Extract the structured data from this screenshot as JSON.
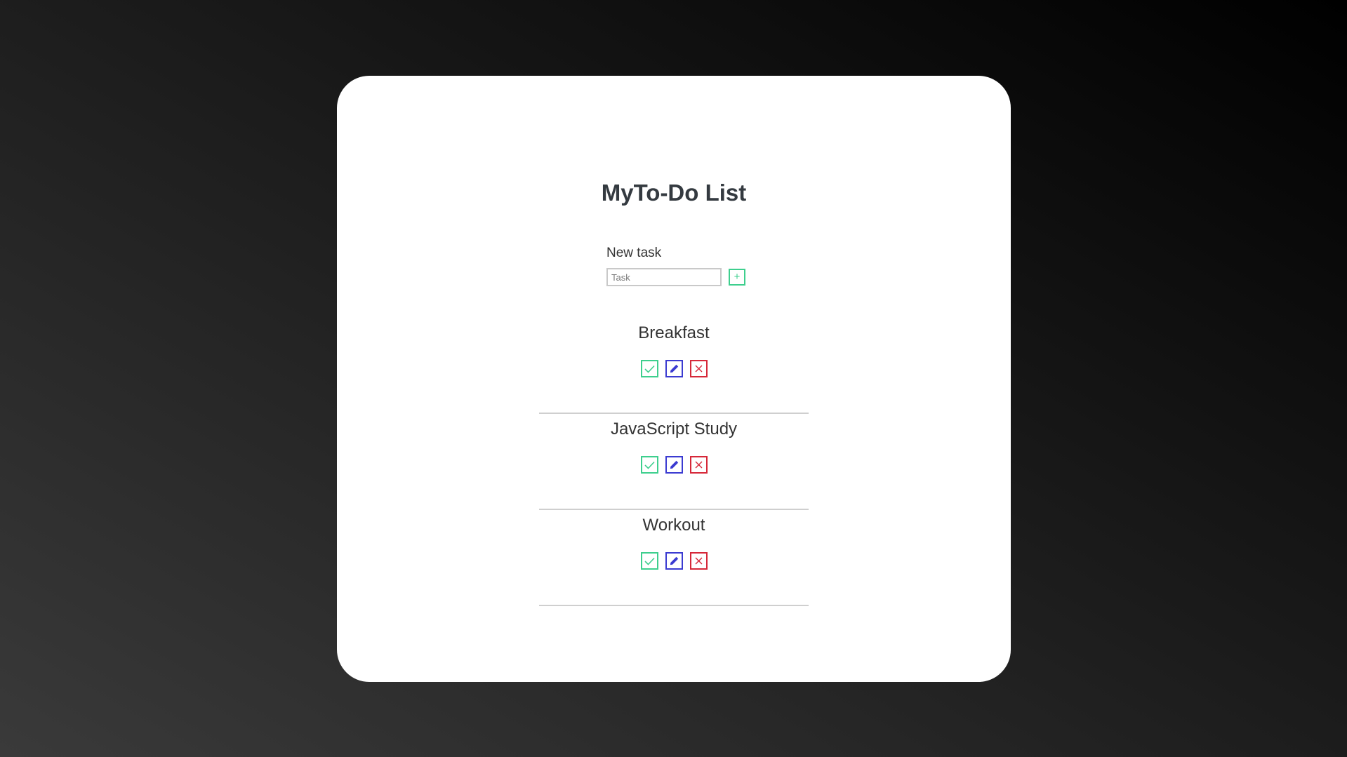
{
  "app": {
    "title": "MyTo-Do List"
  },
  "new_task": {
    "label": "New task",
    "input_value": "",
    "input_placeholder": "Task",
    "add_button_label": "+"
  },
  "todos": [
    {
      "name": "Breakfast"
    },
    {
      "name": "JavaScript Study"
    },
    {
      "name": "Workout"
    }
  ],
  "icons": {
    "complete": "check-icon",
    "edit": "pencil-icon",
    "delete": "close-icon"
  },
  "colors": {
    "complete": "#3ecf8e",
    "edit": "#3b3bd1",
    "delete": "#d62839",
    "title": "#343a40"
  }
}
